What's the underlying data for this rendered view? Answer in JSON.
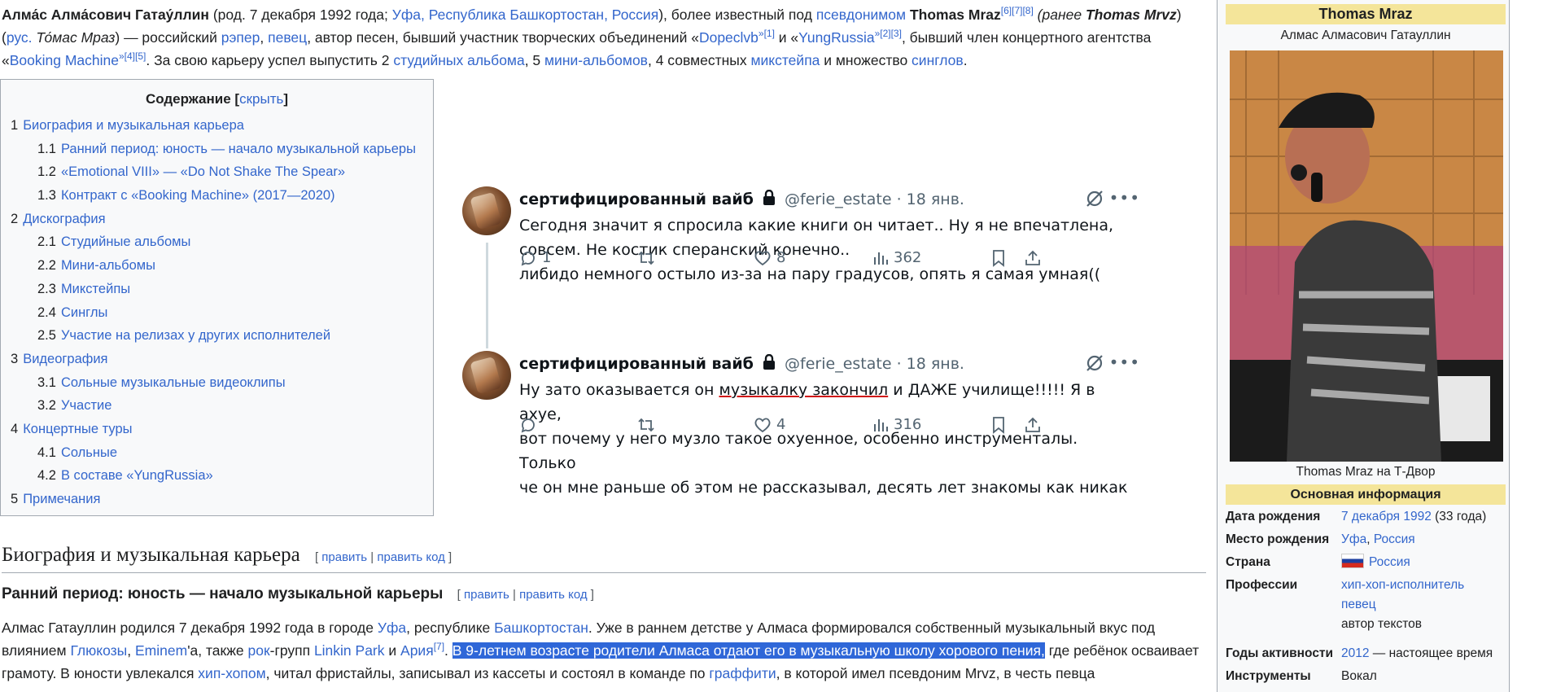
{
  "lead": {
    "p1_name": "Алма́с Алма́сович Гатау́ллин",
    "p1_born": " (род. 7 декабря 1992 года; ",
    "p1_place": "Уфа, Республика Башкортостан, Россия",
    "p1_known": "), более известный под ",
    "p1_pseudo": "псевдонимом",
    "p1_stage": " Thomas Mraz",
    "p1_refs1": "[6][7][8]",
    "p1_prev": " (ранее ",
    "p1_prev_name": "Thomas Mrvz",
    "p1_rus_open": ") (",
    "p1_rus": "рус.",
    "p1_rus_name": " То́мас Мраз",
    "p1_dash": ") — российский ",
    "p1_rapper": "рэпер",
    "p1_comma": ", ",
    "p1_singer": "певец",
    "p1_author": ", автор песен, бывший участник творческих объединений «",
    "p1_dopeclvb": "Dopeclvb",
    "p1_ref2": "»[1]",
    "p1_and": " и «",
    "p1_yung": "YungRussia",
    "p1_ref3": "»[2][3]",
    "p1_member": ", бывший член концертного агентства «",
    "p1_booking": "Booking Machine",
    "p1_ref4": "»[4][5]",
    "p1_career": ". За свою карьеру успел выпустить 2 ",
    "p1_studio": "студийных альбома",
    "p1_five": ", 5 ",
    "p1_mini": "мини-альбомов",
    "p1_four": ", 4 совместных ",
    "p1_mixtape": "микстейпа",
    "p1_many": " и множество ",
    "p1_singles": "синглов",
    "p1_end": "."
  },
  "toc": {
    "title": "Содержание",
    "toggle": "скрыть",
    "items": [
      {
        "num": "1",
        "label": "Биография и музыкальная карьера"
      },
      {
        "num": "1.1",
        "label": "Ранний период: юность — начало музыкальной карьеры"
      },
      {
        "num": "1.2",
        "label": "«Emotional VIII» — «Do Not Shake The Spear»"
      },
      {
        "num": "1.3",
        "label": "Контракт с «Booking Machine» (2017—2020)"
      },
      {
        "num": "2",
        "label": "Дискография"
      },
      {
        "num": "2.1",
        "label": "Студийные альбомы"
      },
      {
        "num": "2.2",
        "label": "Мини-альбомы"
      },
      {
        "num": "2.3",
        "label": "Микстейпы"
      },
      {
        "num": "2.4",
        "label": "Синглы"
      },
      {
        "num": "2.5",
        "label": "Участие на релизах у других исполнителей"
      },
      {
        "num": "3",
        "label": "Видеография"
      },
      {
        "num": "3.1",
        "label": "Сольные музыкальные видеоклипы"
      },
      {
        "num": "3.2",
        "label": "Участие"
      },
      {
        "num": "4",
        "label": "Концертные туры"
      },
      {
        "num": "4.1",
        "label": "Сольные"
      },
      {
        "num": "4.2",
        "label": "В составе «YungRussia»"
      },
      {
        "num": "5",
        "label": "Примечания"
      }
    ]
  },
  "tweets": [
    {
      "name": "сертифицированный вайб",
      "handle": "@ferie_estate",
      "date": "· 18 янв.",
      "line1": "Сегодня значит я спросила какие книги он читает.. Ну я не впечатлена,",
      "line2": "совсем. Не костик сперанский конечно..",
      "line3": "либидо немного остыло из-за на пару градусов, опять я самая умная((",
      "replies": "1",
      "likes": "8",
      "views": "362"
    },
    {
      "name": "сертифицированный вайб",
      "handle": "@ferie_estate",
      "date": "· 18 янв.",
      "pre": "Ну зато оказывается он ",
      "underlined": "музыкалку закончил",
      "post": " и ДАЖЕ училище!!!!! Я в ахуе,",
      "line2": "вот почему у него музло такое охуенное, особенно инструменталы. Только",
      "line3": "че он мне раньше об этом не рассказывал, десять лет знакомы как никак",
      "replies": "",
      "likes": "4",
      "views": "316"
    }
  ],
  "article": {
    "h2": "Биография и музыкальная карьера",
    "edit": "править",
    "edit_code": "править код",
    "h3": "Ранний период: юность — начало музыкальной карьеры",
    "s1": "Алмас Гатауллин родился 7 декабря 1992 года в городе ",
    "ufa": "Уфа",
    "s2": ", республике ",
    "bash": "Башкортостан",
    "s3": ". Уже в раннем детстве у Алмаса формировался собственный музыкальный вкус под влиянием ",
    "glukoza": "Глюкозы",
    "s4": ", ",
    "eminem": "Eminem",
    "s5": "'а, также ",
    "rock": "рок",
    "s6": "-групп ",
    "lp": "Linkin Park",
    "s7": " и ",
    "aria": "Ария",
    "ref7": "[7]",
    "s8": ". ",
    "highlight": "В 9-летнем возрасте родители Алмаса отдают его в музыкальную школу хорового пения,",
    "s9": " где ребёнок осваивает грамоту. В юности увлекался ",
    "hiphop": "хип-хопом",
    "s10": ", читал фристайлы, записывал из кассеты и состоял в команде по ",
    "graffiti": "граффити",
    "s11": ", в которой имел псевдоним Mrvz, в честь певца"
  },
  "infobox": {
    "title": "Thomas Mraz",
    "subtitle": "Алмас Алмасович Гатауллин",
    "caption": "Thomas Mraz на Т-Двор",
    "section": "Основная информация",
    "rows": [
      {
        "k": "Дата рождения",
        "v_link": "7 декабря 1992",
        "v_text": " (33 года)"
      },
      {
        "k": "Место рождения",
        "v_link": "Уфа",
        "v_sep": ", ",
        "v_link2": "Россия"
      },
      {
        "k": "Страна",
        "v_link": "Россия"
      },
      {
        "k": "Профессии",
        "v_link": "хип-хоп-исполнитель",
        "v_link2": "певец",
        "v_text": "автор текстов"
      },
      {
        "k": "Годы активности",
        "v_link": "2012",
        "v_text": " — настоящее время"
      },
      {
        "k": "Инструменты",
        "v_text": "Вокал"
      }
    ]
  },
  "colors": {
    "link": "#3366cc",
    "highlight": "#2f67d8",
    "infobox_header": "#f4e59a",
    "underline": "#d01010"
  }
}
